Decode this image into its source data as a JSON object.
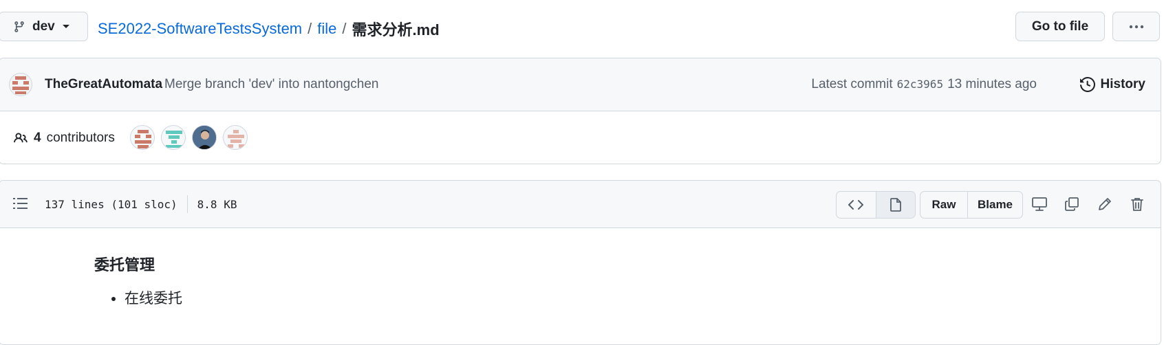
{
  "colors": {
    "link": "#0969da",
    "border": "#d0d7de",
    "muted": "#57606a",
    "bg_subtle": "#f6f8fa",
    "text": "#1f2328"
  },
  "branch": {
    "name": "dev",
    "icon": "git-branch-icon"
  },
  "breadcrumb": {
    "repo": "SE2022-SoftwareTestsSystem",
    "sep1": "/",
    "folder": "file",
    "sep2": "/",
    "file": "需求分析.md"
  },
  "header": {
    "goto_label": "Go to file",
    "more_icon": "kebab-horizontal-icon"
  },
  "commit": {
    "author": "TheGreatAutomata",
    "message": "Merge branch 'dev' into nantongchen",
    "latest_label": "Latest commit",
    "sha": "62c3965",
    "time": "13 minutes ago",
    "history_label": "History"
  },
  "contributors": {
    "count": "4",
    "label": "contributors"
  },
  "file": {
    "lines": "137 lines (101 sloc)",
    "size": "8.8 KB",
    "raw_label": "Raw",
    "blame_label": "Blame"
  },
  "markdown": {
    "heading": "委托管理",
    "items": [
      "在线委托"
    ]
  }
}
